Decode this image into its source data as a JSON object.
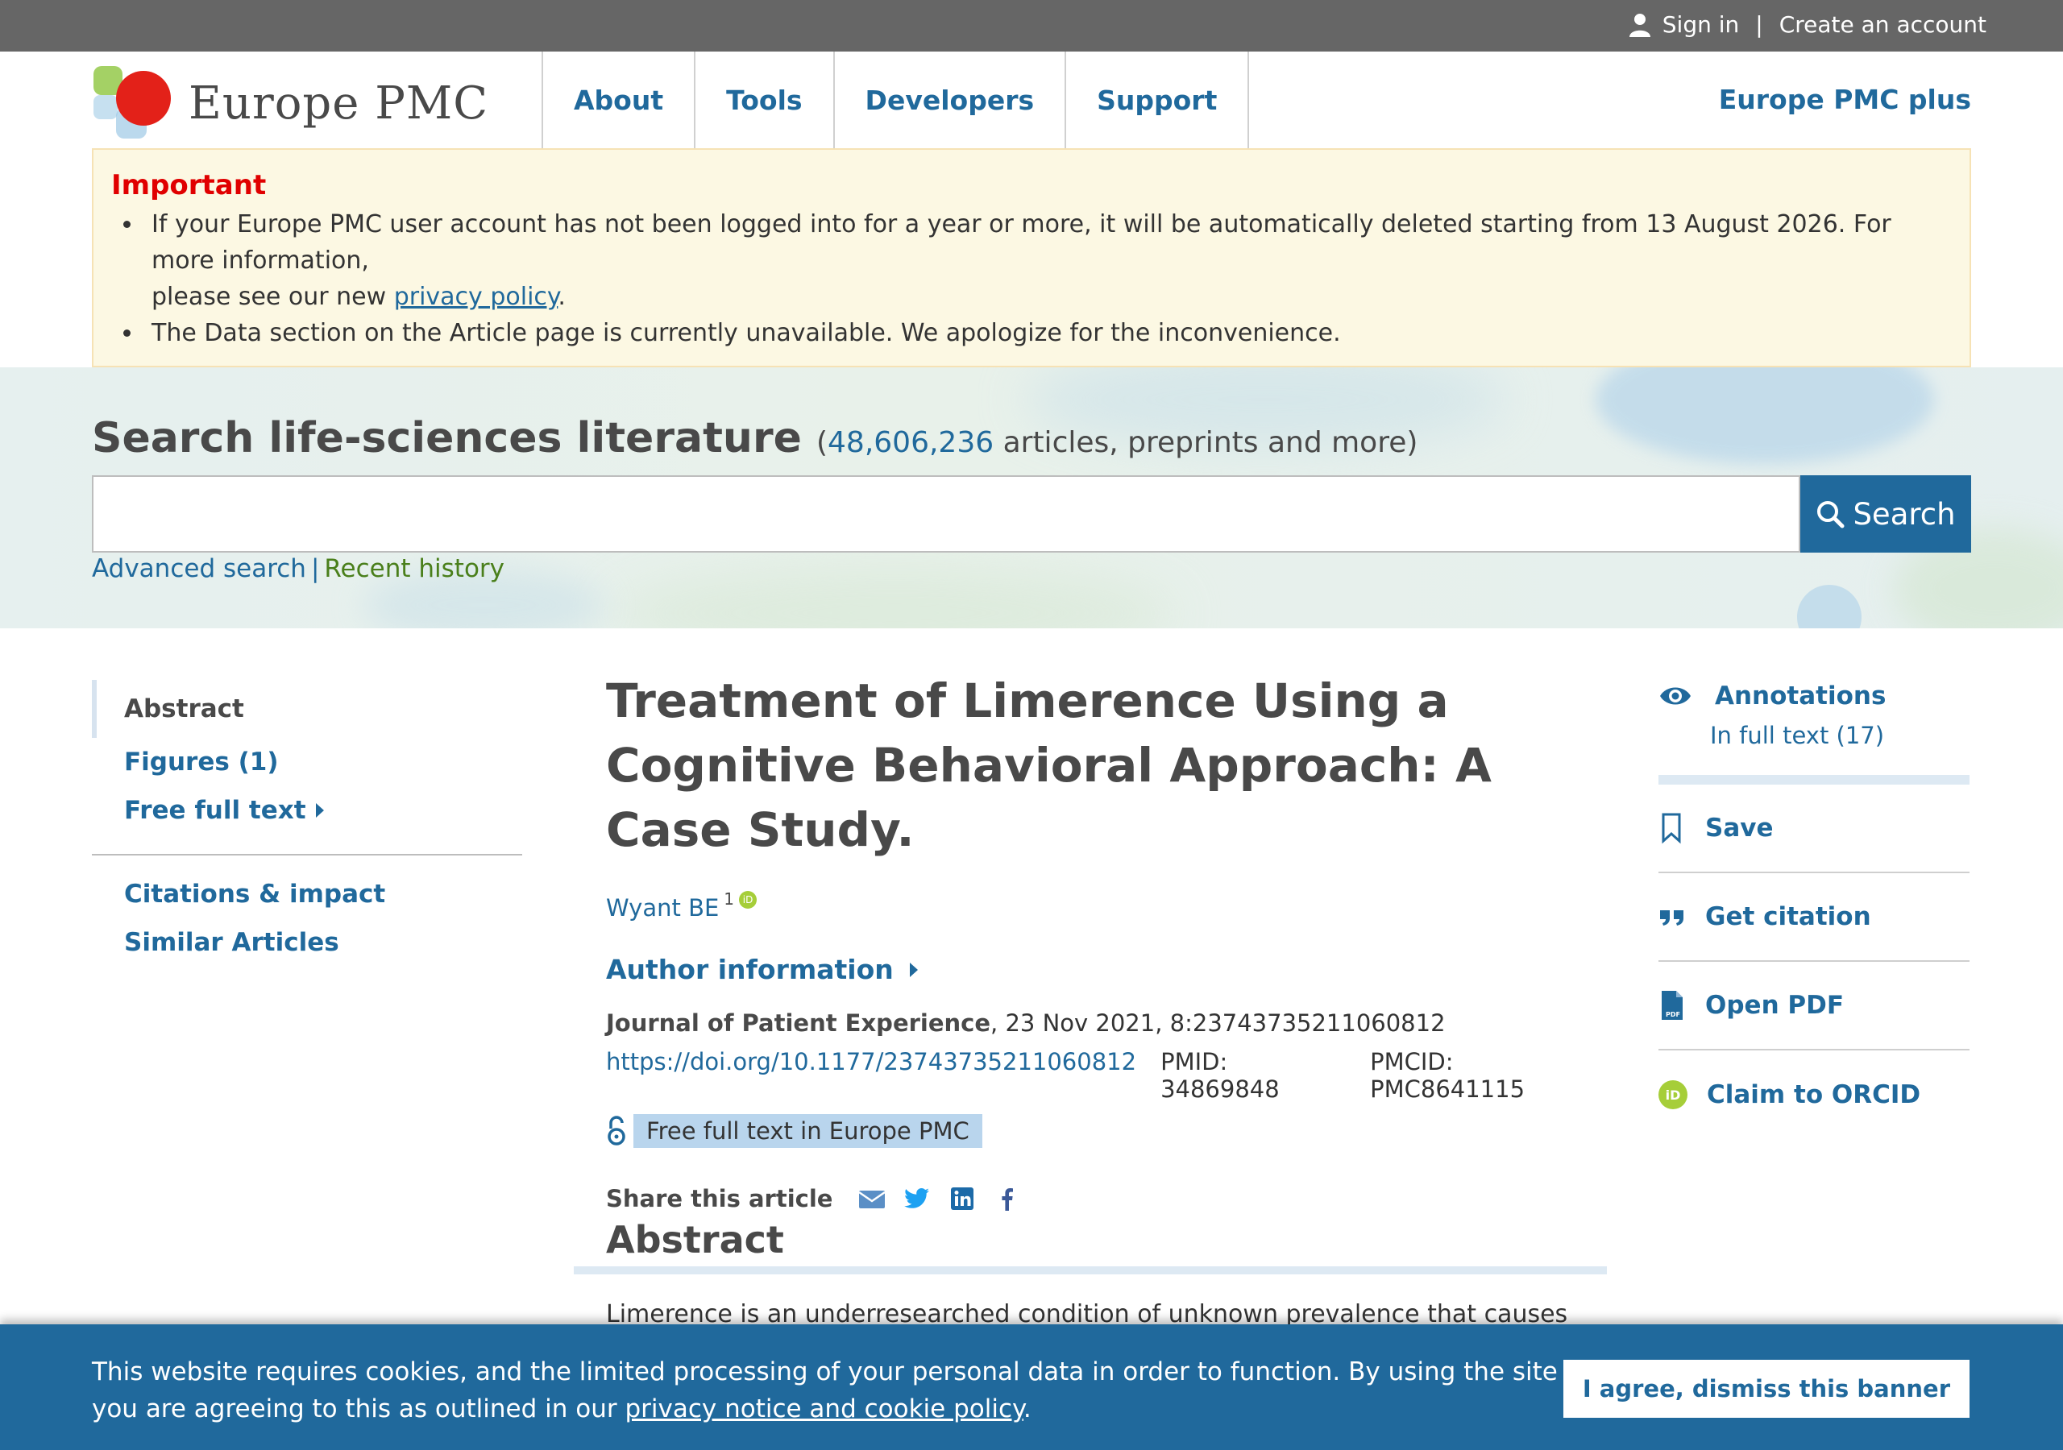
{
  "account": {
    "sign_in": "Sign in",
    "separator": "|",
    "create": "Create an account"
  },
  "header": {
    "logo_text": "Europe PMC",
    "nav": [
      "About",
      "Tools",
      "Developers",
      "Support"
    ],
    "plus": "Europe PMC plus"
  },
  "notice": {
    "heading": "Important",
    "item1_line1": "If your Europe PMC user account has not been logged into for a year or more, it will be automatically deleted starting from 13 August 2026. For more information,",
    "item1_line2_prefix": "please see our new ",
    "item1_link": "privacy policy",
    "item1_suffix": ".",
    "item2": "The Data section on the Article page is currently unavailable. We apologize for the inconvenience."
  },
  "search": {
    "heading": "Search life-sciences literature",
    "count_open": "(",
    "count": "48,606,236",
    "count_rest": " articles, preprints and more)",
    "placeholder": "",
    "button": "Search",
    "advanced": "Advanced search",
    "separator": "|",
    "recent": "Recent history"
  },
  "leftnav": {
    "abstract": "Abstract",
    "figures": "Figures (1)",
    "free_full_text": "Free full text",
    "citations": "Citations & impact",
    "similar": "Similar Articles"
  },
  "article": {
    "title": "Treatment of Limerence Using a Cognitive Behavioral Approach: A Case Study.",
    "author": "Wyant BE",
    "author_sup": "1",
    "author_info": "Author information",
    "journal": "Journal of Patient Experience",
    "journal_rest": ", 23 Nov 2021, 8:23743735211060812",
    "doi": "https://doi.org/10.1177/23743735211060812",
    "pmid": "PMID: 34869848",
    "pmcid": "PMCID: PMC8641115",
    "free_full_text_badge": "Free full text in Europe PMC",
    "share_label": "Share this article",
    "abstract_heading": "Abstract",
    "abstract_start": "Limerence is an underresearched condition of unknown prevalence that causes"
  },
  "rightnav": {
    "annotations": "Annotations",
    "in_full_text": "In full text (17)",
    "save": "Save",
    "get_citation": "Get citation",
    "open_pdf": "Open PDF",
    "claim_orcid": "Claim to ORCID"
  },
  "cookie": {
    "line1": "This website requires cookies, and the limited processing of your personal data in order to function. By using the site you are agreeing to this as outlined in our ",
    "link": "privacy notice and cookie policy",
    "suffix": ".",
    "button": "I agree, dismiss this banner"
  },
  "colors": {
    "brand_blue": "#20699c",
    "topbar": "#666666",
    "notice_bg": "#fcf8e3",
    "important_red": "#e00000",
    "orcid_green": "#a6ce39"
  }
}
